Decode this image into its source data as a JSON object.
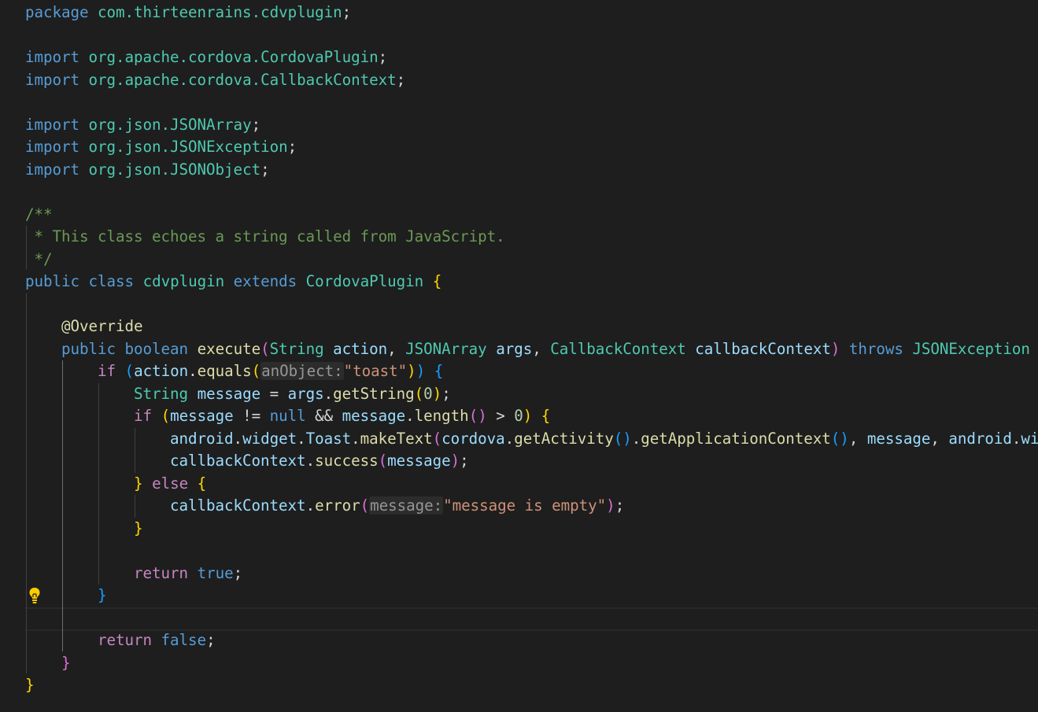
{
  "editor": {
    "lines": [
      {
        "tokens": [
          {
            "c": "kw",
            "t": "package"
          },
          {
            "c": "pl",
            "t": " "
          },
          {
            "c": "pkg",
            "t": "com.thirteenrains.cdvplugin"
          },
          {
            "c": "pl",
            "t": ";"
          }
        ]
      },
      {
        "tokens": []
      },
      {
        "tokens": [
          {
            "c": "kw",
            "t": "import"
          },
          {
            "c": "pl",
            "t": " "
          },
          {
            "c": "pkg",
            "t": "org.apache.cordova.CordovaPlugin"
          },
          {
            "c": "pl",
            "t": ";"
          }
        ]
      },
      {
        "tokens": [
          {
            "c": "kw",
            "t": "import"
          },
          {
            "c": "pl",
            "t": " "
          },
          {
            "c": "pkg",
            "t": "org.apache.cordova.CallbackContext"
          },
          {
            "c": "pl",
            "t": ";"
          }
        ]
      },
      {
        "tokens": []
      },
      {
        "tokens": [
          {
            "c": "kw",
            "t": "import"
          },
          {
            "c": "pl",
            "t": " "
          },
          {
            "c": "pkg",
            "t": "org.json.JSONArray"
          },
          {
            "c": "pl",
            "t": ";"
          }
        ]
      },
      {
        "tokens": [
          {
            "c": "kw",
            "t": "import"
          },
          {
            "c": "pl",
            "t": " "
          },
          {
            "c": "pkg",
            "t": "org.json.JSONException"
          },
          {
            "c": "pl",
            "t": ";"
          }
        ]
      },
      {
        "tokens": [
          {
            "c": "kw",
            "t": "import"
          },
          {
            "c": "pl",
            "t": " "
          },
          {
            "c": "pkg",
            "t": "org.json.JSONObject"
          },
          {
            "c": "pl",
            "t": ";"
          }
        ]
      },
      {
        "tokens": []
      },
      {
        "tokens": [
          {
            "c": "cm",
            "t": "/**"
          }
        ]
      },
      {
        "tokens": [
          {
            "c": "cm",
            "t": " * This class echoes a string called from JavaScript."
          }
        ]
      },
      {
        "tokens": [
          {
            "c": "cm",
            "t": " */"
          }
        ]
      },
      {
        "tokens": [
          {
            "c": "kw",
            "t": "public"
          },
          {
            "c": "pl",
            "t": " "
          },
          {
            "c": "kw",
            "t": "class"
          },
          {
            "c": "pl",
            "t": " "
          },
          {
            "c": "ty",
            "t": "cdvplugin"
          },
          {
            "c": "pl",
            "t": " "
          },
          {
            "c": "kw",
            "t": "extends"
          },
          {
            "c": "pl",
            "t": " "
          },
          {
            "c": "ty",
            "t": "CordovaPlugin"
          },
          {
            "c": "pl",
            "t": " "
          },
          {
            "c": "b1",
            "t": "{"
          }
        ]
      },
      {
        "tokens": []
      },
      {
        "tokens": [
          {
            "c": "pl",
            "t": "    "
          },
          {
            "c": "ann",
            "t": "@Override"
          }
        ]
      },
      {
        "tokens": [
          {
            "c": "pl",
            "t": "    "
          },
          {
            "c": "kw",
            "t": "public"
          },
          {
            "c": "pl",
            "t": " "
          },
          {
            "c": "kw",
            "t": "boolean"
          },
          {
            "c": "pl",
            "t": " "
          },
          {
            "c": "fn",
            "t": "execute"
          },
          {
            "c": "b2",
            "t": "("
          },
          {
            "c": "ty",
            "t": "String"
          },
          {
            "c": "pl",
            "t": " "
          },
          {
            "c": "var",
            "t": "action"
          },
          {
            "c": "pl",
            "t": ", "
          },
          {
            "c": "ty",
            "t": "JSONArray"
          },
          {
            "c": "pl",
            "t": " "
          },
          {
            "c": "var",
            "t": "args"
          },
          {
            "c": "pl",
            "t": ", "
          },
          {
            "c": "ty",
            "t": "CallbackContext"
          },
          {
            "c": "pl",
            "t": " "
          },
          {
            "c": "var",
            "t": "callbackContext"
          },
          {
            "c": "b2",
            "t": ")"
          },
          {
            "c": "pl",
            "t": " "
          },
          {
            "c": "kw",
            "t": "throws"
          },
          {
            "c": "pl",
            "t": " "
          },
          {
            "c": "ty",
            "t": "JSONException"
          }
        ]
      },
      {
        "tokens": [
          {
            "c": "pl",
            "t": "        "
          },
          {
            "c": "ctl",
            "t": "if"
          },
          {
            "c": "pl",
            "t": " "
          },
          {
            "c": "b3",
            "t": "("
          },
          {
            "c": "var",
            "t": "action"
          },
          {
            "c": "pl",
            "t": "."
          },
          {
            "c": "fn",
            "t": "equals"
          },
          {
            "c": "b1",
            "t": "("
          },
          {
            "c": "hint",
            "t": "anObject:"
          },
          {
            "c": "str",
            "t": "\"toast\""
          },
          {
            "c": "b1",
            "t": ")"
          },
          {
            "c": "b3",
            "t": ")"
          },
          {
            "c": "pl",
            "t": " "
          },
          {
            "c": "b3",
            "t": "{"
          }
        ]
      },
      {
        "tokens": [
          {
            "c": "pl",
            "t": "            "
          },
          {
            "c": "ty",
            "t": "String"
          },
          {
            "c": "pl",
            "t": " "
          },
          {
            "c": "var",
            "t": "message"
          },
          {
            "c": "pl",
            "t": " = "
          },
          {
            "c": "var",
            "t": "args"
          },
          {
            "c": "pl",
            "t": "."
          },
          {
            "c": "fn",
            "t": "getString"
          },
          {
            "c": "b1",
            "t": "("
          },
          {
            "c": "num",
            "t": "0"
          },
          {
            "c": "b1",
            "t": ")"
          },
          {
            "c": "pl",
            "t": ";"
          }
        ]
      },
      {
        "tokens": [
          {
            "c": "pl",
            "t": "            "
          },
          {
            "c": "ctl",
            "t": "if"
          },
          {
            "c": "pl",
            "t": " "
          },
          {
            "c": "b1",
            "t": "("
          },
          {
            "c": "var",
            "t": "message"
          },
          {
            "c": "pl",
            "t": " != "
          },
          {
            "c": "kw",
            "t": "null"
          },
          {
            "c": "pl",
            "t": " && "
          },
          {
            "c": "var",
            "t": "message"
          },
          {
            "c": "pl",
            "t": "."
          },
          {
            "c": "fn",
            "t": "length"
          },
          {
            "c": "b2",
            "t": "()"
          },
          {
            "c": "pl",
            "t": " > "
          },
          {
            "c": "num",
            "t": "0"
          },
          {
            "c": "b1",
            "t": ")"
          },
          {
            "c": "pl",
            "t": " "
          },
          {
            "c": "b1",
            "t": "{"
          }
        ]
      },
      {
        "tokens": [
          {
            "c": "pl",
            "t": "                "
          },
          {
            "c": "var",
            "t": "android"
          },
          {
            "c": "pl",
            "t": "."
          },
          {
            "c": "var",
            "t": "widget"
          },
          {
            "c": "pl",
            "t": "."
          },
          {
            "c": "var",
            "t": "Toast"
          },
          {
            "c": "pl",
            "t": "."
          },
          {
            "c": "fn",
            "t": "makeText"
          },
          {
            "c": "b2",
            "t": "("
          },
          {
            "c": "var",
            "t": "cordova"
          },
          {
            "c": "pl",
            "t": "."
          },
          {
            "c": "fn",
            "t": "getActivity"
          },
          {
            "c": "b3",
            "t": "()"
          },
          {
            "c": "pl",
            "t": "."
          },
          {
            "c": "fn",
            "t": "getApplicationContext"
          },
          {
            "c": "b3",
            "t": "()"
          },
          {
            "c": "pl",
            "t": ", "
          },
          {
            "c": "var",
            "t": "message"
          },
          {
            "c": "pl",
            "t": ", "
          },
          {
            "c": "var",
            "t": "android"
          },
          {
            "c": "pl",
            "t": "."
          },
          {
            "c": "var",
            "t": "wi"
          }
        ]
      },
      {
        "tokens": [
          {
            "c": "pl",
            "t": "                "
          },
          {
            "c": "var",
            "t": "callbackContext"
          },
          {
            "c": "pl",
            "t": "."
          },
          {
            "c": "fn",
            "t": "success"
          },
          {
            "c": "b2",
            "t": "("
          },
          {
            "c": "var",
            "t": "message"
          },
          {
            "c": "b2",
            "t": ")"
          },
          {
            "c": "pl",
            "t": ";"
          }
        ]
      },
      {
        "tokens": [
          {
            "c": "pl",
            "t": "            "
          },
          {
            "c": "b1",
            "t": "}"
          },
          {
            "c": "pl",
            "t": " "
          },
          {
            "c": "ctl",
            "t": "else"
          },
          {
            "c": "pl",
            "t": " "
          },
          {
            "c": "b1",
            "t": "{"
          }
        ]
      },
      {
        "tokens": [
          {
            "c": "pl",
            "t": "                "
          },
          {
            "c": "var",
            "t": "callbackContext"
          },
          {
            "c": "pl",
            "t": "."
          },
          {
            "c": "fn",
            "t": "error"
          },
          {
            "c": "b2",
            "t": "("
          },
          {
            "c": "hint",
            "t": "message:"
          },
          {
            "c": "str",
            "t": "\"message is empty\""
          },
          {
            "c": "b2",
            "t": ")"
          },
          {
            "c": "pl",
            "t": ";"
          }
        ]
      },
      {
        "tokens": [
          {
            "c": "pl",
            "t": "            "
          },
          {
            "c": "b1",
            "t": "}"
          }
        ]
      },
      {
        "tokens": []
      },
      {
        "tokens": [
          {
            "c": "pl",
            "t": "            "
          },
          {
            "c": "ctl",
            "t": "return"
          },
          {
            "c": "pl",
            "t": " "
          },
          {
            "c": "kw",
            "t": "true"
          },
          {
            "c": "pl",
            "t": ";"
          }
        ]
      },
      {
        "tokens": [
          {
            "c": "pl",
            "t": "        "
          },
          {
            "c": "b3",
            "t": "}"
          }
        ]
      },
      {
        "tokens": []
      },
      {
        "tokens": [
          {
            "c": "pl",
            "t": "        "
          },
          {
            "c": "ctl",
            "t": "return"
          },
          {
            "c": "pl",
            "t": " "
          },
          {
            "c": "kw",
            "t": "false"
          },
          {
            "c": "pl",
            "t": ";"
          }
        ]
      },
      {
        "tokens": [
          {
            "c": "pl",
            "t": "    "
          },
          {
            "c": "b2",
            "t": "}"
          }
        ]
      },
      {
        "tokens": [
          {
            "c": "b1",
            "t": "}"
          }
        ]
      }
    ],
    "current_line": 27,
    "lightbulb_line": 26
  },
  "colors": {
    "background": "#1e1e1e",
    "keyword": "#569cd6",
    "control": "#c586c0",
    "type": "#4ec9b0",
    "function": "#dcdcaa",
    "variable": "#9cdcfe",
    "string": "#ce9178",
    "comment": "#6a9955",
    "lightbulb": "#ffcc00"
  },
  "icons": {
    "code_action": "lightbulb-icon"
  }
}
